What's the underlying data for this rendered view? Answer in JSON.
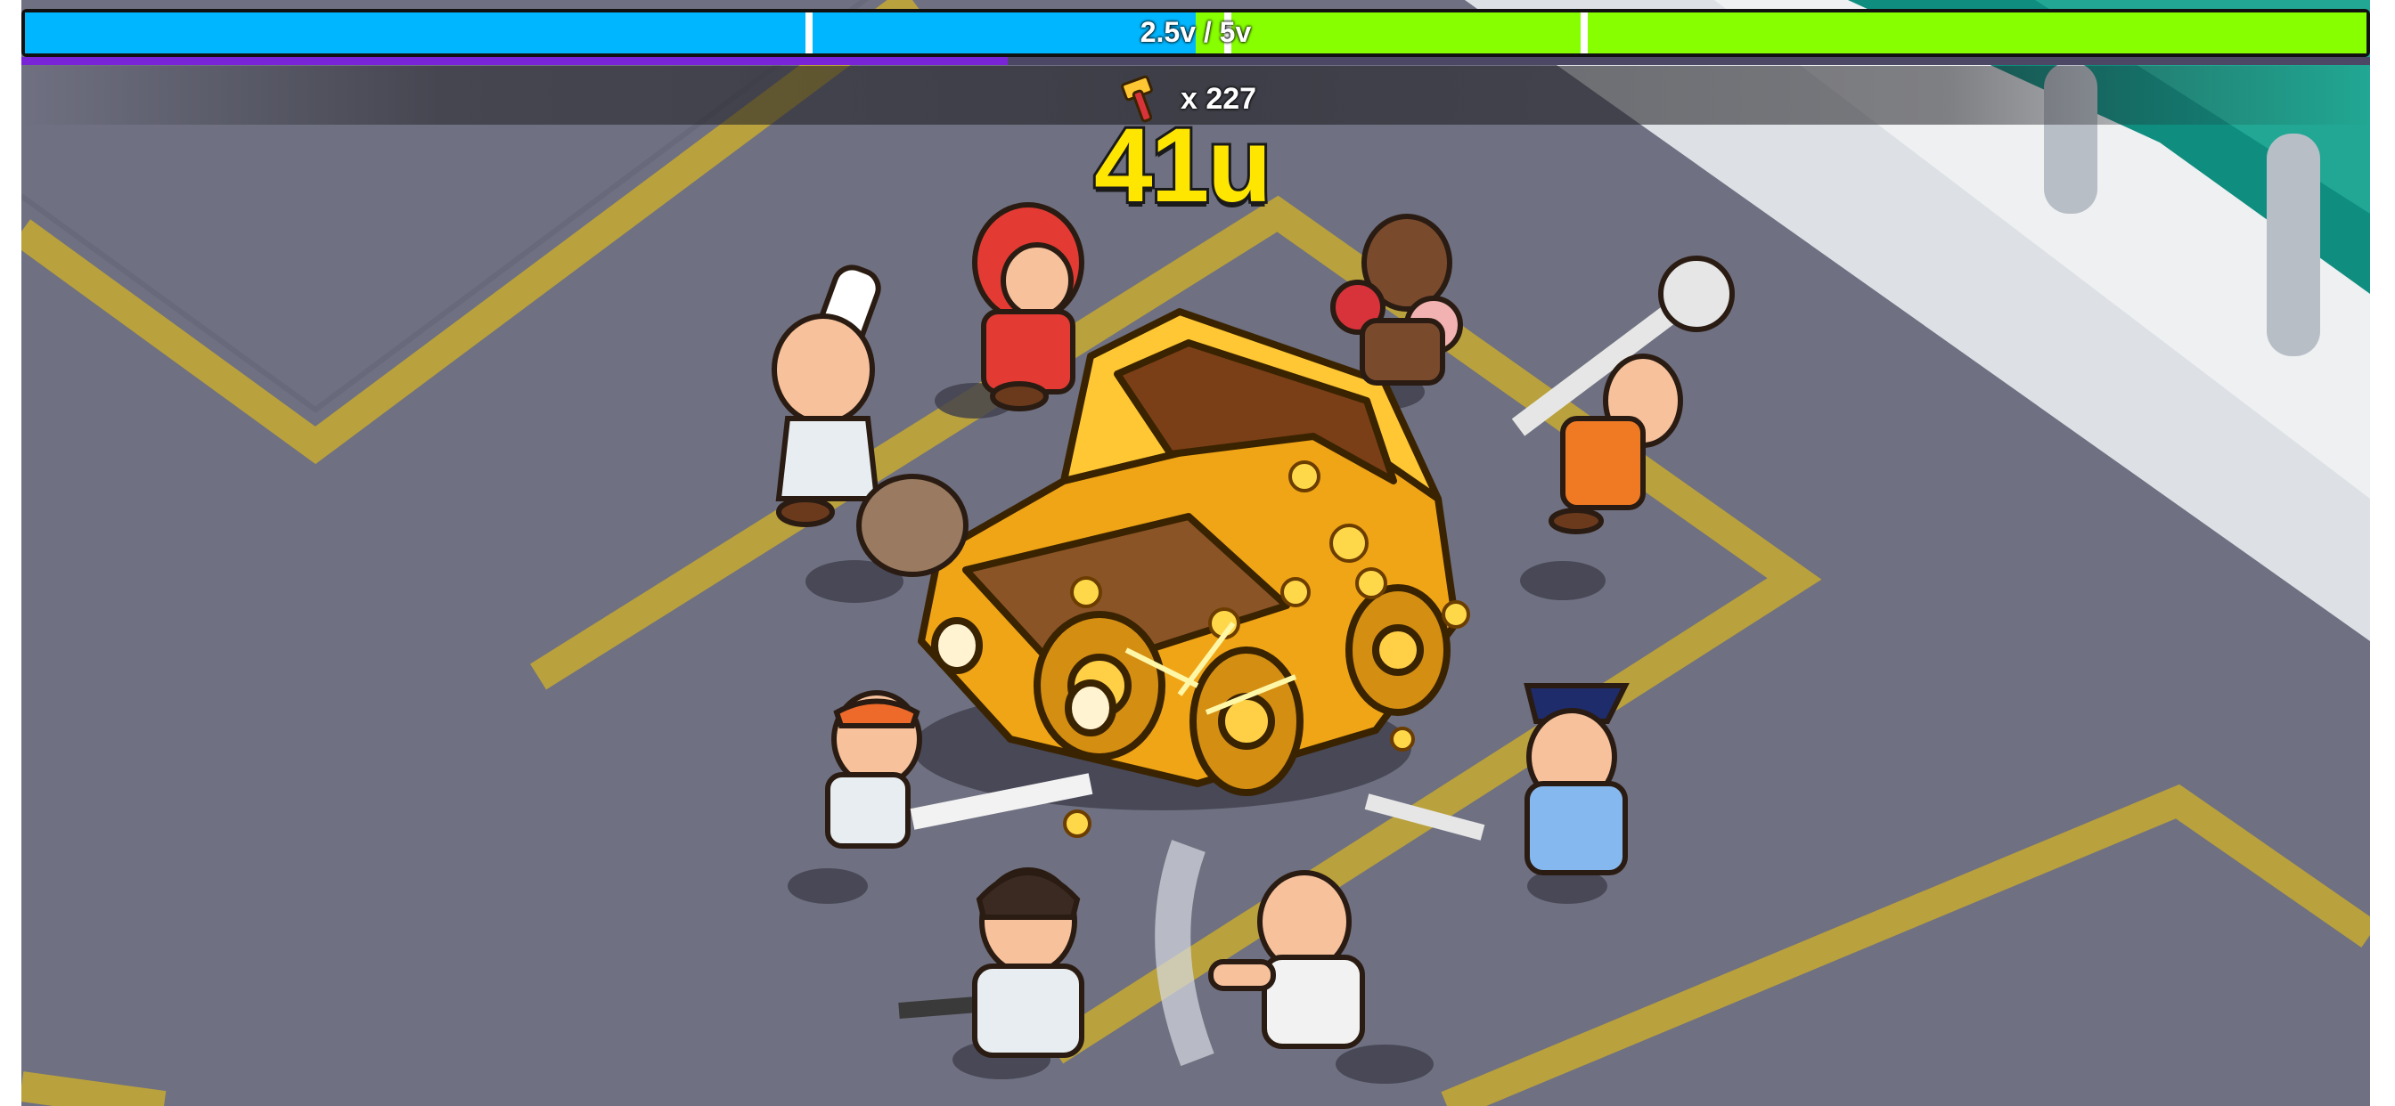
{
  "hud": {
    "progress_text": "2.5v / 5v",
    "progress_fraction": 0.5,
    "secondary_fraction": 0.42,
    "hit_count": "x 227",
    "damage_value": "41u"
  },
  "icons": {
    "hit_counter": "hammer-icon"
  },
  "colors": {
    "progress_left": "#00b7ff",
    "progress_right": "#87ff00",
    "secondary_bar": "#7a24d8",
    "damage_text": "#ffe600"
  }
}
